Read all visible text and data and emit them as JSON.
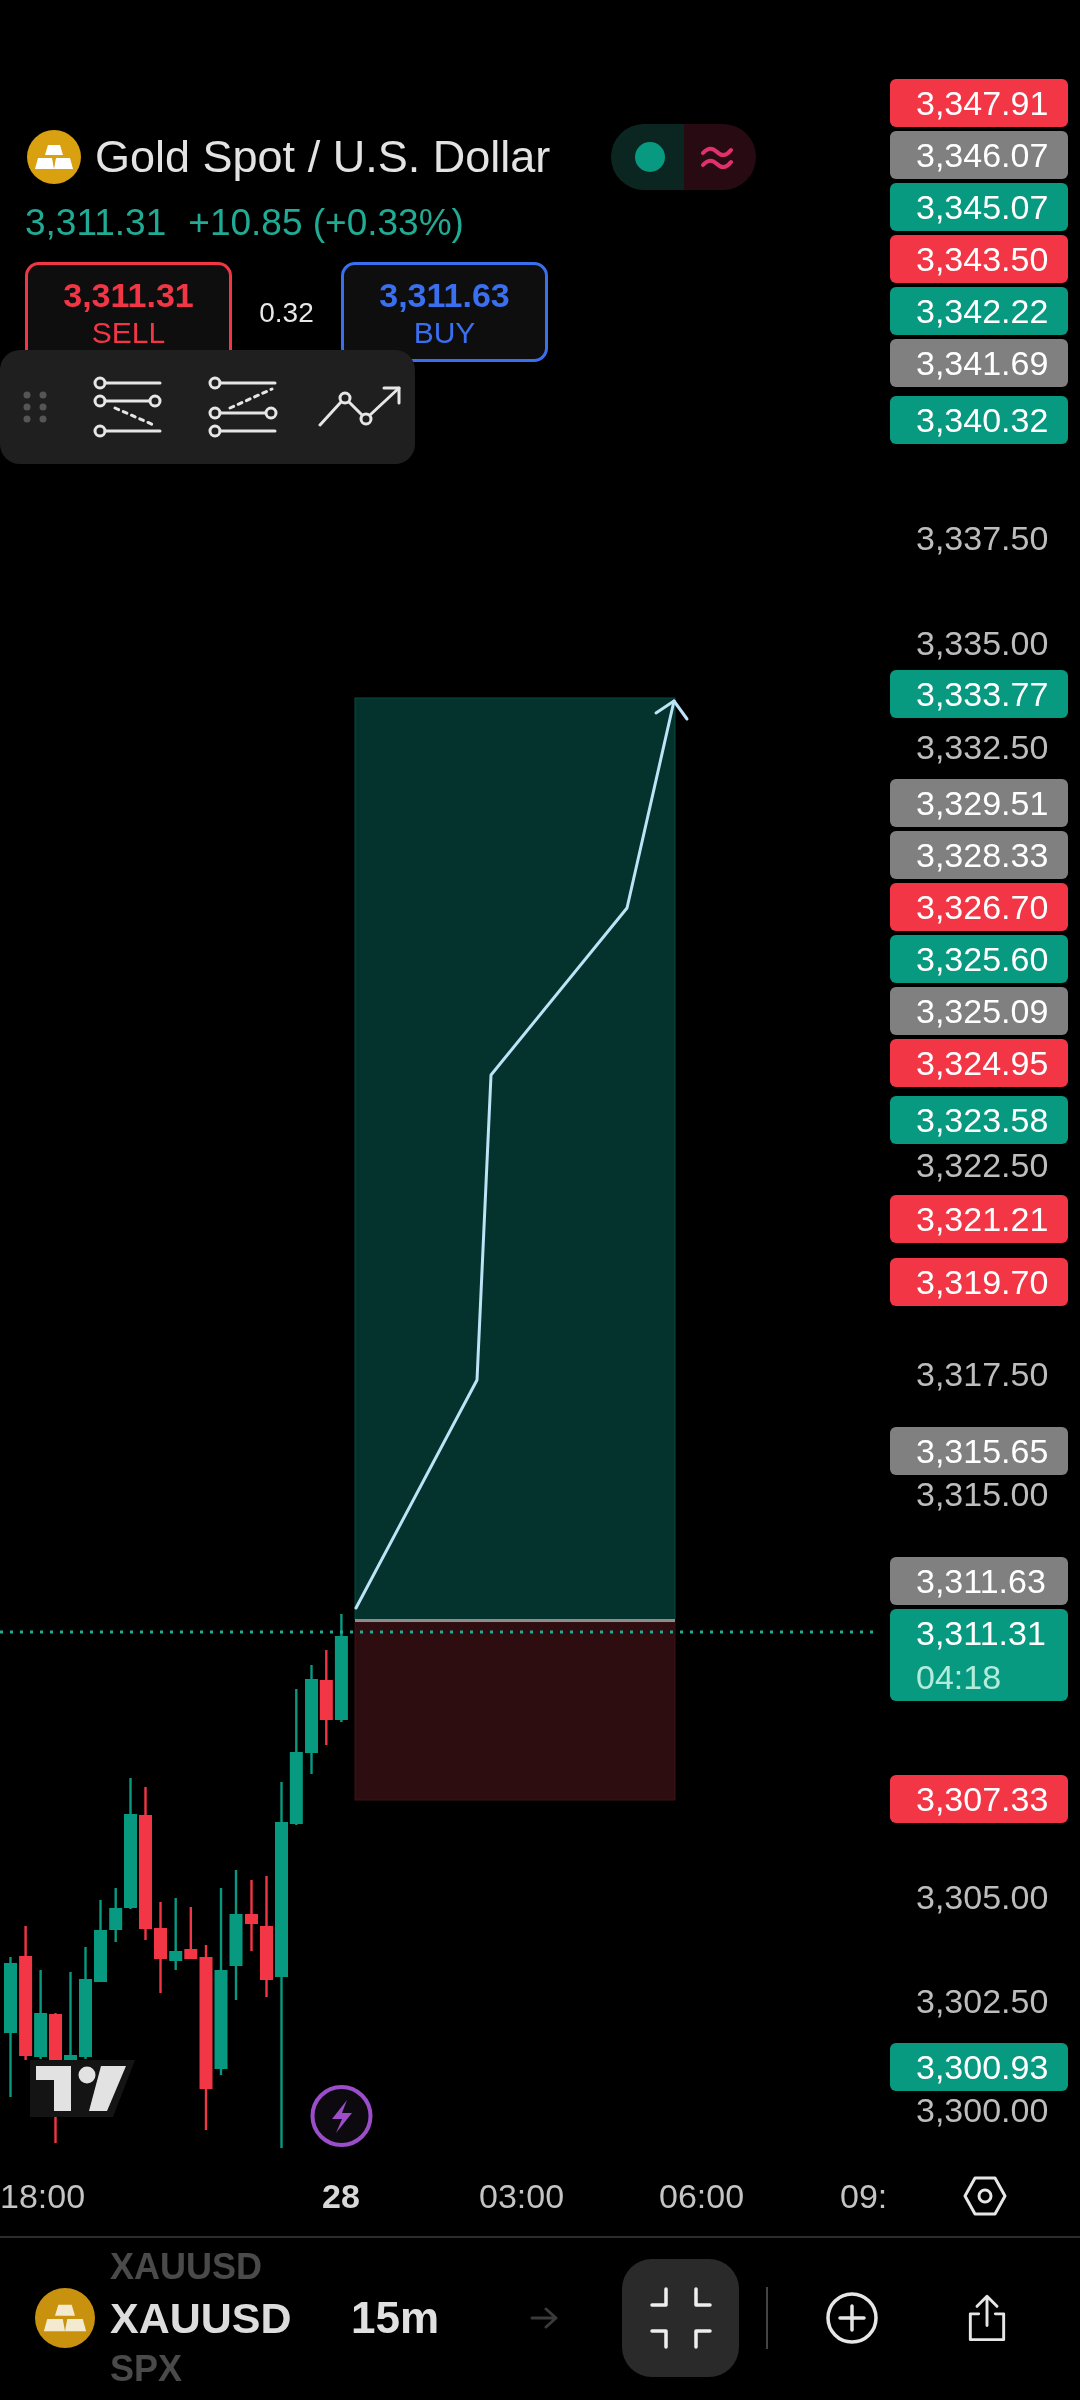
{
  "legend": {
    "title": "Gold Spot / U.S. Dollar",
    "market_open": true,
    "last_price": "3,311.31",
    "change": "+10.85 (+0.33%)"
  },
  "trade": {
    "sell": {
      "price": "3,311.31",
      "label": "SELL"
    },
    "spread": "0.32",
    "buy": {
      "price": "3,311.63",
      "label": "BUY"
    }
  },
  "price_axis": {
    "labels": [
      {
        "price": "3,347.91",
        "color": "#f23645"
      },
      {
        "price": "3,346.07",
        "color": "#808080"
      },
      {
        "price": "3,345.07",
        "color": "#089981"
      },
      {
        "price": "3,343.50",
        "color": "#f23645"
      },
      {
        "price": "3,342.22",
        "color": "#089981"
      },
      {
        "price": "3,341.69",
        "color": "#808080"
      },
      {
        "price": "3,340.32",
        "color": "#089981"
      },
      {
        "price": "3,333.77",
        "color": "#089981"
      },
      {
        "price": "3,329.51",
        "color": "#808080"
      },
      {
        "price": "3,328.33",
        "color": "#808080"
      },
      {
        "price": "3,326.70",
        "color": "#f23645"
      },
      {
        "price": "3,325.60",
        "color": "#089981"
      },
      {
        "price": "3,325.09",
        "color": "#808080"
      },
      {
        "price": "3,324.95",
        "color": "#f23645"
      },
      {
        "price": "3,323.58",
        "color": "#089981"
      },
      {
        "price": "3,321.21",
        "color": "#f23645"
      },
      {
        "price": "3,319.70",
        "color": "#f23645"
      },
      {
        "price": "3,315.65",
        "color": "#808080"
      },
      {
        "price": "3,311.63",
        "color": "#808080"
      },
      {
        "price": "3,311.31",
        "color": "#089981",
        "countdown": "04:18"
      },
      {
        "price": "3,307.33",
        "color": "#f23645"
      },
      {
        "price": "3,300.93",
        "color": "#089981"
      }
    ],
    "ticks": [
      "3,337.50",
      "3,335.00",
      "3,332.50",
      "3,322.50",
      "3,317.50",
      "3,315.00",
      "3,305.00",
      "3,302.50",
      "3,300.00"
    ]
  },
  "time_axis": [
    {
      "label": "18:00",
      "kind": "time"
    },
    {
      "label": "28",
      "kind": "day"
    },
    {
      "label": "03:00",
      "kind": "time"
    },
    {
      "label": "06:00",
      "kind": "time"
    },
    {
      "label": "09:",
      "kind": "time"
    }
  ],
  "bottom_bar": {
    "symbols": [
      {
        "label": "XAUUSD",
        "selected": false
      },
      {
        "label": "XAUUSD",
        "selected": true
      },
      {
        "label": "SPX",
        "selected": false
      }
    ],
    "interval": "15m"
  }
}
